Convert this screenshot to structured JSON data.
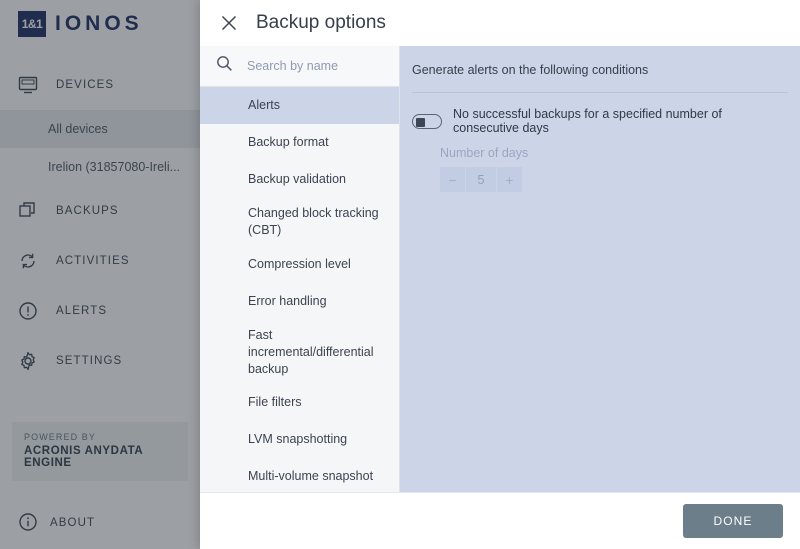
{
  "sidebar": {
    "brand": {
      "mark": "1&1",
      "name": "IONOS"
    },
    "nav": [
      {
        "label": "DEVICES",
        "icon": "monitor-icon"
      },
      {
        "label": "BACKUPS",
        "icon": "layers-icon"
      },
      {
        "label": "ACTIVITIES",
        "icon": "refresh-icon"
      },
      {
        "label": "ALERTS",
        "icon": "exclamation-circle-icon"
      },
      {
        "label": "SETTINGS",
        "icon": "gear-icon"
      }
    ],
    "devices_children": [
      {
        "label": "All devices",
        "active": true
      },
      {
        "label": "Irelion (31857080-Ireli...",
        "active": false
      }
    ],
    "powered": {
      "line1": "POWERED BY",
      "line2": "ACRONIS ANYDATA ENGINE"
    },
    "about": {
      "label": "ABOUT",
      "icon": "info-circle-icon"
    }
  },
  "modal": {
    "title": "Backup options",
    "close_icon": "close-icon",
    "search": {
      "placeholder": "Search by name",
      "value": "",
      "icon": "search-icon"
    },
    "options": [
      {
        "label": "Alerts",
        "selected": true
      },
      {
        "label": "Backup format",
        "selected": false
      },
      {
        "label": "Backup validation",
        "selected": false
      },
      {
        "label": "Changed block tracking (CBT)",
        "selected": false
      },
      {
        "label": "Compression level",
        "selected": false
      },
      {
        "label": "Error handling",
        "selected": false
      },
      {
        "label": "Fast incremental/differential backup",
        "selected": false
      },
      {
        "label": "File filters",
        "selected": false
      },
      {
        "label": "LVM snapshotting",
        "selected": false
      },
      {
        "label": "Multi-volume snapshot",
        "selected": false
      }
    ],
    "pane": {
      "heading": "Generate alerts on the following conditions",
      "condition_label": "No successful backups for a specified number of consecutive days",
      "toggle_state": "off",
      "number_label": "Number of days",
      "number_value": "5",
      "minus": "−",
      "plus": "+"
    },
    "footer": {
      "done_label": "DONE"
    }
  },
  "colors": {
    "brand_navy": "#1c2b60",
    "pane_bg": "#ccd5e8",
    "list_bg": "#f5f6f8",
    "done_button": "#6b7e8a"
  }
}
